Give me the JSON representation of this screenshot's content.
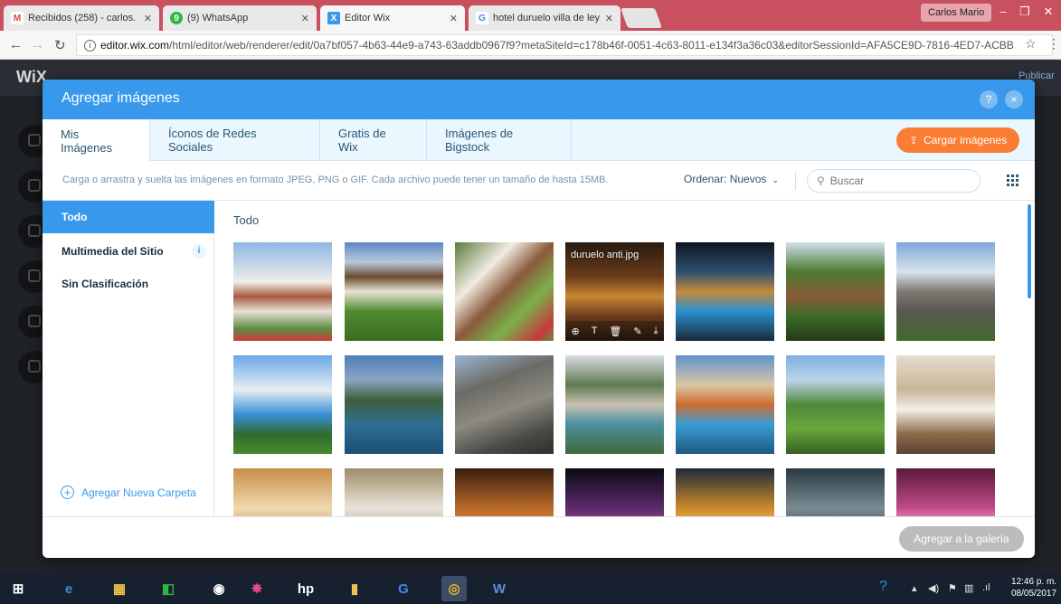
{
  "browser": {
    "tabs": [
      {
        "title": "Recibidos (258) - carlos.",
        "icon": "gmail-icon",
        "color": "#d44638",
        "glyph": "M"
      },
      {
        "title": "(9) WhatsApp",
        "icon": "whatsapp-icon",
        "color": "#2fb742",
        "glyph": "9"
      },
      {
        "title": "Editor Wix",
        "icon": "wix-icon",
        "color": "#3899ec",
        "glyph": "X"
      },
      {
        "title": "hotel duruelo villa de ley",
        "icon": "google-icon",
        "color": "#4285f4",
        "glyph": "G"
      }
    ],
    "profile": "Carlos Mario",
    "url_host": "editor.wix.com",
    "url_path": "/html/editor/web/renderer/edit/0a7bf057-4b63-44e9-a743-63addb0967f9?metaSiteId=c178b46f-0051-4c63-8011-e134f3a36c03&editorSessionId=AFA5CE9D-7816-4ED7-ACBB"
  },
  "editor": {
    "logo": "WiX",
    "publish": "Publicar"
  },
  "modal": {
    "title": "Agregar imágenes",
    "help": "?",
    "close": "×",
    "tabs": [
      "Mis Imágenes",
      "Íconos de Redes Sociales",
      "Gratis de Wix",
      "Imágenes de Bigstock"
    ],
    "upload_label": "Cargar imágenes",
    "hint": "Carga o arrastra y suelta las imágenes en formato JPEG, PNG o GIF. Cada archivo puede tener un tamaño de hasta 15MB.",
    "sort_label": "Ordenar: Nuevos",
    "search_placeholder": "Buscar",
    "sidebar": {
      "items": [
        "Todo",
        "Multimedia del Sitio",
        "Sin Clasificación"
      ],
      "info_badge": "i",
      "add_folder": "Agregar Nueva Carpeta"
    },
    "gallery_title": "Todo",
    "hover_filename": "duruelo anti.jpg",
    "hover_actions": [
      "⊕",
      "T",
      "🗑",
      "✎",
      "⤓"
    ],
    "footer_button": "Agregar a la galería"
  },
  "taskbar": {
    "time": "12:46 p. m.",
    "date": "08/05/2017"
  },
  "colors": {
    "accent": "#3899ec",
    "upload": "#fb7d33",
    "tabbar": "#c9505f"
  }
}
